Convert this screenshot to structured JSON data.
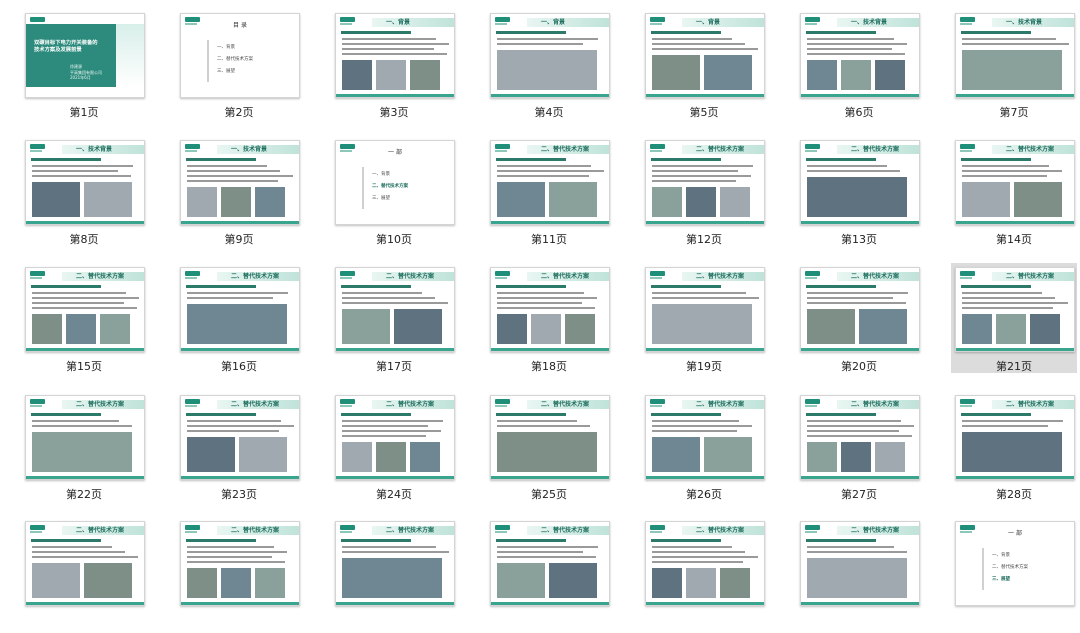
{
  "cover": {
    "title_line1": "双碳目标下电力开关装备的",
    "title_line2": "技术方案及发展前景",
    "author": "徐建源",
    "org": "平高集团有限公司",
    "date": "2021年6月"
  },
  "toc": {
    "title": "目 录",
    "title_section1": "一 部",
    "items": [
      "一、背景",
      "二、替代技术方案",
      "三、展望"
    ]
  },
  "section_titles": {
    "background": "一、背景",
    "technical": "一、技术背景",
    "alternative": "二、替代技术方案",
    "outlook": "三、展望"
  },
  "selected_page": 21,
  "pages": [
    {
      "label": "第1页",
      "kind": "cover"
    },
    {
      "label": "第2页",
      "kind": "toc",
      "active": -1
    },
    {
      "label": "第3页",
      "kind": "content",
      "section": "background"
    },
    {
      "label": "第4页",
      "kind": "content",
      "section": "background"
    },
    {
      "label": "第5页",
      "kind": "content",
      "section": "background"
    },
    {
      "label": "第6页",
      "kind": "content",
      "section": "technical"
    },
    {
      "label": "第7页",
      "kind": "content",
      "section": "technical"
    },
    {
      "label": "第8页",
      "kind": "content",
      "section": "technical"
    },
    {
      "label": "第9页",
      "kind": "content",
      "section": "technical"
    },
    {
      "label": "第10页",
      "kind": "toc",
      "active": 1
    },
    {
      "label": "第11页",
      "kind": "content",
      "section": "alternative"
    },
    {
      "label": "第12页",
      "kind": "content",
      "section": "alternative"
    },
    {
      "label": "第13页",
      "kind": "content",
      "section": "alternative"
    },
    {
      "label": "第14页",
      "kind": "content",
      "section": "alternative"
    },
    {
      "label": "第15页",
      "kind": "content",
      "section": "alternative"
    },
    {
      "label": "第16页",
      "kind": "content",
      "section": "alternative"
    },
    {
      "label": "第17页",
      "kind": "content",
      "section": "alternative"
    },
    {
      "label": "第18页",
      "kind": "content",
      "section": "alternative"
    },
    {
      "label": "第19页",
      "kind": "content",
      "section": "alternative"
    },
    {
      "label": "第20页",
      "kind": "content",
      "section": "alternative"
    },
    {
      "label": "第21页",
      "kind": "content",
      "section": "alternative"
    },
    {
      "label": "第22页",
      "kind": "content",
      "section": "alternative"
    },
    {
      "label": "第23页",
      "kind": "content",
      "section": "alternative"
    },
    {
      "label": "第24页",
      "kind": "content",
      "section": "alternative"
    },
    {
      "label": "第25页",
      "kind": "content",
      "section": "alternative"
    },
    {
      "label": "第26页",
      "kind": "content",
      "section": "alternative"
    },
    {
      "label": "第27页",
      "kind": "content",
      "section": "alternative"
    },
    {
      "label": "第28页",
      "kind": "content",
      "section": "alternative"
    },
    {
      "label": "",
      "kind": "content",
      "section": "alternative"
    },
    {
      "label": "",
      "kind": "content",
      "section": "alternative"
    },
    {
      "label": "",
      "kind": "content",
      "section": "alternative"
    },
    {
      "label": "",
      "kind": "content",
      "section": "alternative"
    },
    {
      "label": "",
      "kind": "content",
      "section": "alternative"
    },
    {
      "label": "",
      "kind": "content",
      "section": "alternative"
    },
    {
      "label": "",
      "kind": "toc",
      "active": 2
    }
  ]
}
